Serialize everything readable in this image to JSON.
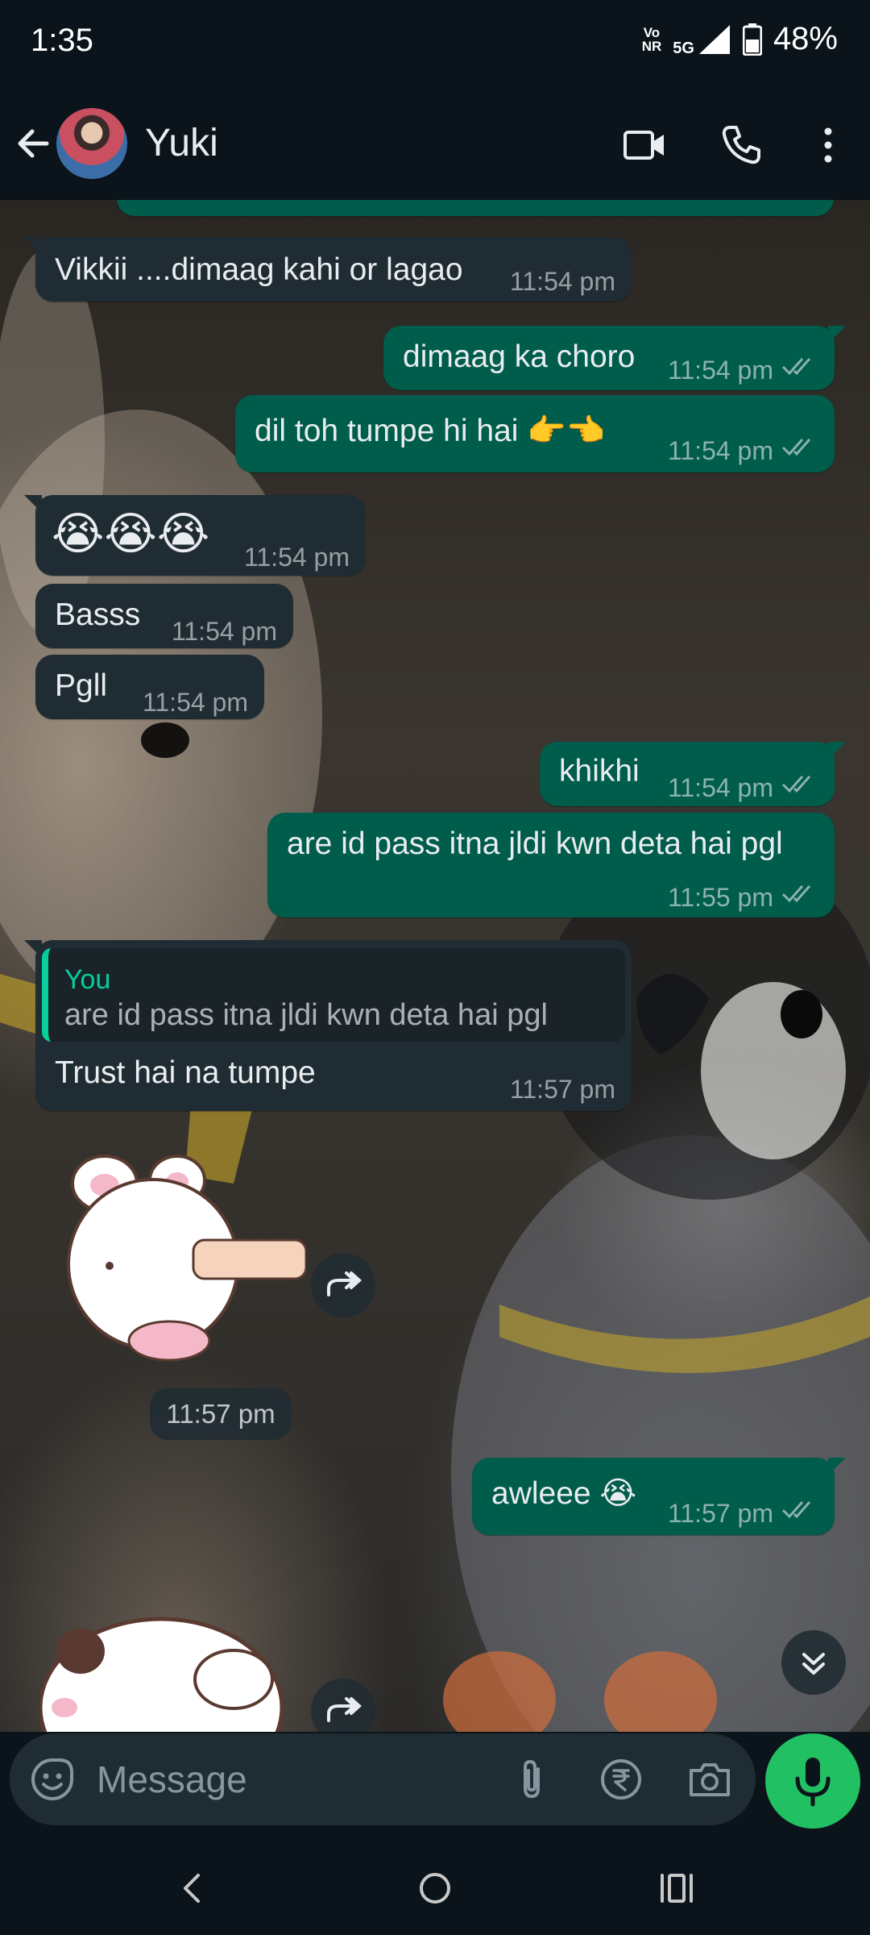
{
  "status_bar": {
    "time": "1:35",
    "network_top": "Vo",
    "network_mid": "NR",
    "network_type": "5G",
    "battery": "48%"
  },
  "header": {
    "contact_name": "Yuki"
  },
  "messages": [
    {
      "dir": "in",
      "text": "Vikkii ....dimaag kahi or lagao",
      "time": "11:54 pm"
    },
    {
      "dir": "out",
      "text": "dimaag ka choro",
      "time": "11:54 pm"
    },
    {
      "dir": "out",
      "text": "dil toh tumpe hi hai",
      "time": "11:54 pm",
      "emoji": "👉👈"
    },
    {
      "dir": "in",
      "emoji": "😭😭😭",
      "time": "11:54 pm"
    },
    {
      "dir": "in",
      "text": "Basss",
      "time": "11:54 pm"
    },
    {
      "dir": "in",
      "text": "Pgll",
      "time": "11:54 pm"
    },
    {
      "dir": "out",
      "text": "khikhi",
      "time": "11:54 pm"
    },
    {
      "dir": "out",
      "text": "are id pass itna jldi kwn deta hai pgl",
      "time": "11:55 pm"
    },
    {
      "dir": "in",
      "quote_author": "You",
      "quote_text": "are id pass itna jldi kwn deta hai pgl",
      "text": "Trust hai na tumpe",
      "time": "11:57 pm"
    },
    {
      "dir": "in",
      "sticker": "bunny-poke-sticker",
      "time": "11:57 pm"
    },
    {
      "dir": "out",
      "text": "awleee",
      "time": "11:57 pm",
      "emoji": "😭"
    },
    {
      "dir": "in",
      "sticker": "sleeping-bear-sticker"
    }
  ],
  "input": {
    "placeholder": "Message"
  },
  "icons": {
    "back": "arrow-left-icon",
    "video": "video-call-icon",
    "call": "phone-icon",
    "menu": "more-vert-icon",
    "emoji": "emoji-icon",
    "attach": "paperclip-icon",
    "payment": "rupee-icon",
    "camera": "camera-icon",
    "mic": "mic-icon"
  },
  "colors": {
    "incoming": "#202c33",
    "outgoing": "#005c4b",
    "accent": "#21c063",
    "quote_bar": "#06cf9c"
  }
}
